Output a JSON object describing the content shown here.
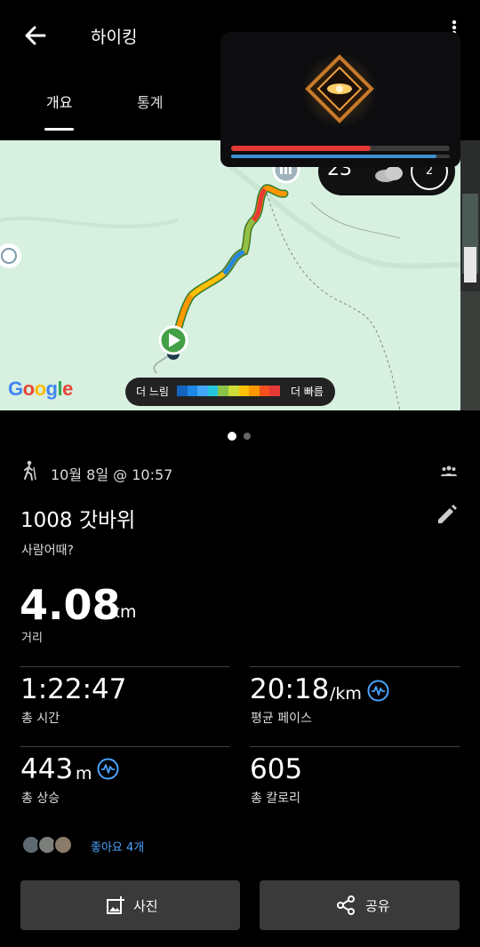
{
  "app_bar": {
    "title": "하이킹"
  },
  "tabs": [
    {
      "label": "개요"
    },
    {
      "label": "통계"
    }
  ],
  "map": {
    "weather": {
      "temp": "23°",
      "badge": "2"
    },
    "legend": {
      "slow_label": "더 느림",
      "fast_label": "더 빠름",
      "colors": [
        "#1565c0",
        "#1e88e5",
        "#42a5f5",
        "#26c6da",
        "#8bc34a",
        "#cddc39",
        "#ffc107",
        "#ff9800",
        "#f4511e",
        "#e53935"
      ]
    },
    "google_logo": "Google"
  },
  "activity": {
    "date": "10월 8일 @ 10:57",
    "name": "1008 갓바위",
    "description": "사람어때?"
  },
  "distance": {
    "value": "4.08",
    "unit": "km",
    "label": "거리"
  },
  "stats": {
    "total_time": {
      "value": "1:22:47",
      "label": "총 시간"
    },
    "avg_pace": {
      "value": "20:18",
      "unit": "/km",
      "label": "평균 페이스"
    },
    "total_ascent": {
      "value": "443",
      "unit": "m",
      "label": "총 상승"
    },
    "calories": {
      "value": "605",
      "label": "총 칼로리"
    }
  },
  "likes": {
    "text": "좋아요 4개"
  },
  "actions": {
    "photo_label": "사진",
    "share_label": "공유"
  },
  "colors": {
    "accent_blue": "#4aa3ff",
    "button_bg": "#3a3a3a"
  }
}
